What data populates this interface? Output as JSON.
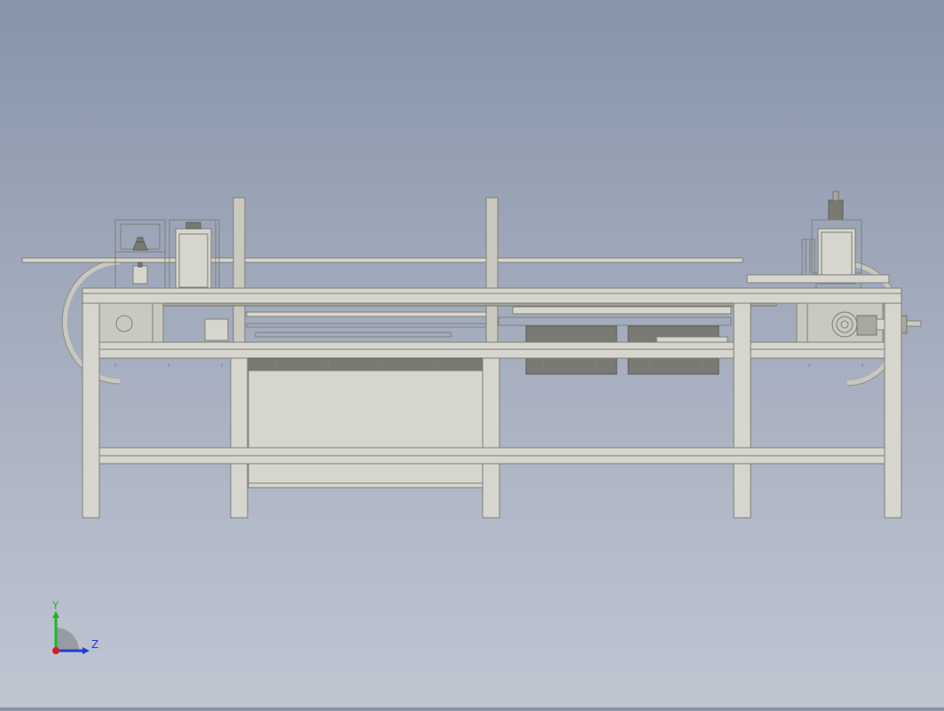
{
  "viewport": {
    "background_top": "#8794a9",
    "background_bottom": "#c0c5d2",
    "model_color": "#c9c9c0",
    "model_edge": "#8e8e86",
    "model_dark": "#6c6c66"
  },
  "triad": {
    "y_label": "Y",
    "z_label": "Z",
    "y_color": "#1fb81f",
    "z_color": "#1f3fd6",
    "x_color": "#d11f1f"
  }
}
